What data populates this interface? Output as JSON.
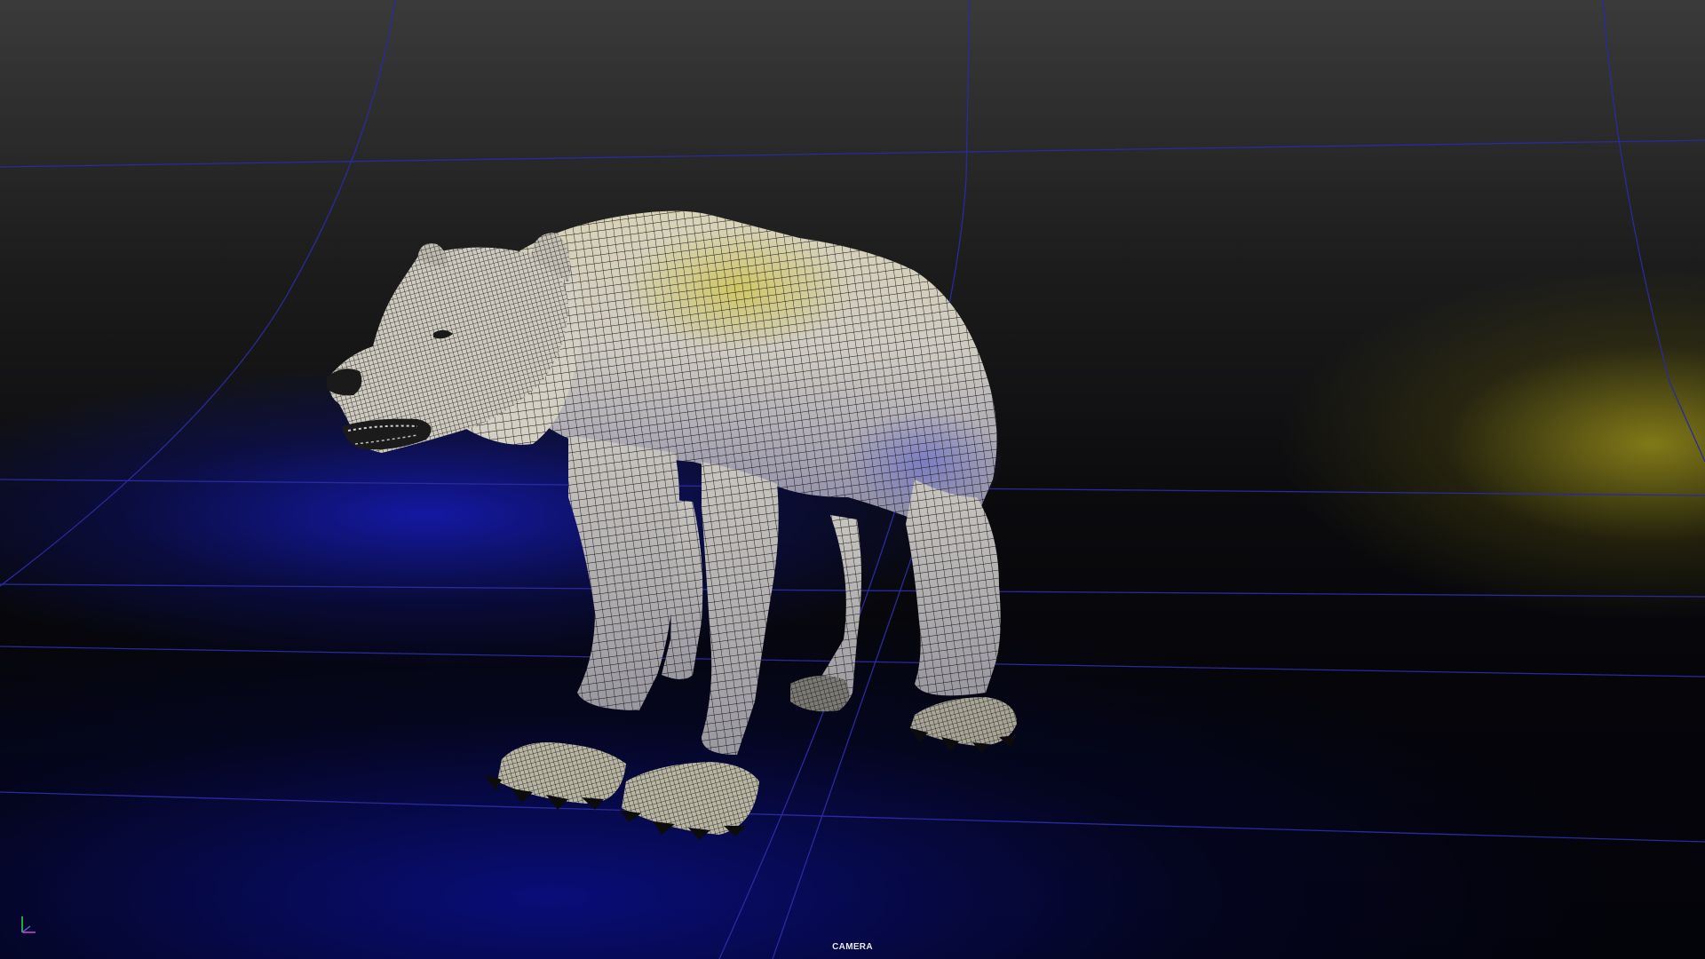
{
  "viewport": {
    "camera_label": "CAMERA"
  },
  "scene": {
    "subject": "bear-wireframe-model",
    "grid_color": "#2a2a9e",
    "wire_color": "#141414",
    "body_color": "#d8d6cc",
    "highlight_color": "#c9c25a",
    "rim_light_color": "#1c22c8"
  },
  "axis_gizmo": {
    "y_axis_color": "#3fd35a",
    "x_axis_color": "#d04ad0"
  }
}
